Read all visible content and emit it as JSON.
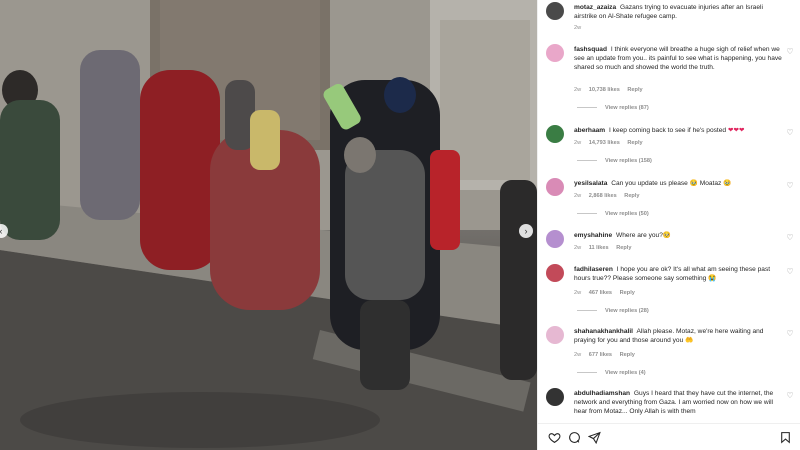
{
  "post": {
    "author": "motaz_azaiza",
    "caption": "Gazans trying to evacuate injuries after an Israeli airstrike on Al-Shate refugee camp.",
    "time": "2w"
  },
  "comments": [
    {
      "username": "fashsquad",
      "text": "I think everyone will breathe a huge sigh of relief when we see an update from you.. its painful to see what is happening, you have shared so much and showed the world the truth.",
      "time": "2w",
      "likes": "10,738 likes",
      "reply": "Reply",
      "view_replies": "View replies (87)",
      "avatar_color": "#e9a7c9"
    },
    {
      "username": "aberhaam",
      "text": "I keep coming back to see if he's posted",
      "hearts": "❤❤❤",
      "time": "2w",
      "likes": "14,793 likes",
      "reply": "Reply",
      "view_replies": "View replies (158)",
      "avatar_color": "#3a7d44"
    },
    {
      "username": "yesilsalata",
      "text": "Can you update us please 🥹 Moataz 🥹",
      "time": "2w",
      "likes": "2,868 likes",
      "reply": "Reply",
      "view_replies": "View replies (50)",
      "avatar_color": "#d98bb6"
    },
    {
      "username": "emyshahine",
      "text": "Where are you?🥺",
      "time": "2w",
      "likes": "11 likes",
      "reply": "Reply",
      "view_replies": "",
      "avatar_color": "#b58fcf"
    },
    {
      "username": "fadhilaseren",
      "text": "I hope you are ok? It's all what am seeing these past hours true?? Please someone say something 😭",
      "time": "2w",
      "likes": "467 likes",
      "reply": "Reply",
      "view_replies": "View replies (28)",
      "avatar_color": "#c24a59"
    },
    {
      "username": "shahanakhankhalil",
      "text": "Allah please. Motaz, we're here waiting and praying for you and those around you 🤲",
      "time": "2w",
      "likes": "677 likes",
      "reply": "Reply",
      "view_replies": "View replies (4)",
      "avatar_color": "#e6b8d2"
    },
    {
      "username": "abdulhadiamshan",
      "text": "Guys I heard that they have cut the internet, the network and everything from Gaza. I am worried now on how we will hear from Motaz... Only Allah is with them",
      "time": "",
      "likes": "",
      "reply": "",
      "view_replies": "",
      "avatar_color": "#333333"
    }
  ],
  "icons": {
    "like": "heart-icon",
    "comment": "comment-icon",
    "share": "share-icon",
    "save": "bookmark-icon"
  }
}
